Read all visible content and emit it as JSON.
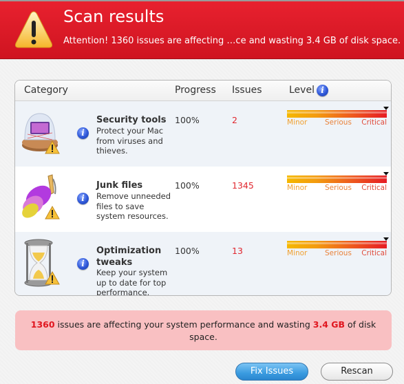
{
  "header": {
    "title": "Scan results",
    "subtitle": "Attention! 1360 issues are affecting …ce and wasting 3.4 GB of disk space.",
    "icon": "warning-icon"
  },
  "table": {
    "columns": {
      "category": "Category",
      "progress": "Progress",
      "issues": "Issues",
      "level": "Level"
    },
    "level_labels": {
      "minor": "Minor",
      "serious": "Serious",
      "critical": "Critical"
    },
    "rows": [
      {
        "name": "Security tools",
        "description": "Protect your Mac from viruses and thieves.",
        "progress": "100%",
        "issues": "2",
        "level": "Critical",
        "icon": "security-globe-icon"
      },
      {
        "name": "Junk files",
        "description": "Remove unneeded files to save system resources.",
        "progress": "100%",
        "issues": "1345",
        "level": "Critical",
        "icon": "feather-duster-icon"
      },
      {
        "name": "Optimization tweaks",
        "description": "Keep your system up to date for top performance.",
        "progress": "100%",
        "issues": "13",
        "level": "Critical",
        "icon": "hourglass-icon"
      }
    ]
  },
  "summary": {
    "count": "1360",
    "text_1": " issues are affecting your system performance and wasting ",
    "size": "3.4 GB",
    "text_2": " of disk space."
  },
  "buttons": {
    "fix": "Fix Issues",
    "rescan": "Rescan"
  },
  "colors": {
    "header_red": "#d91a26",
    "issue_red": "#e0262e",
    "summary_bg": "#f9c0c2",
    "fix_blue": "#3a9be0"
  }
}
